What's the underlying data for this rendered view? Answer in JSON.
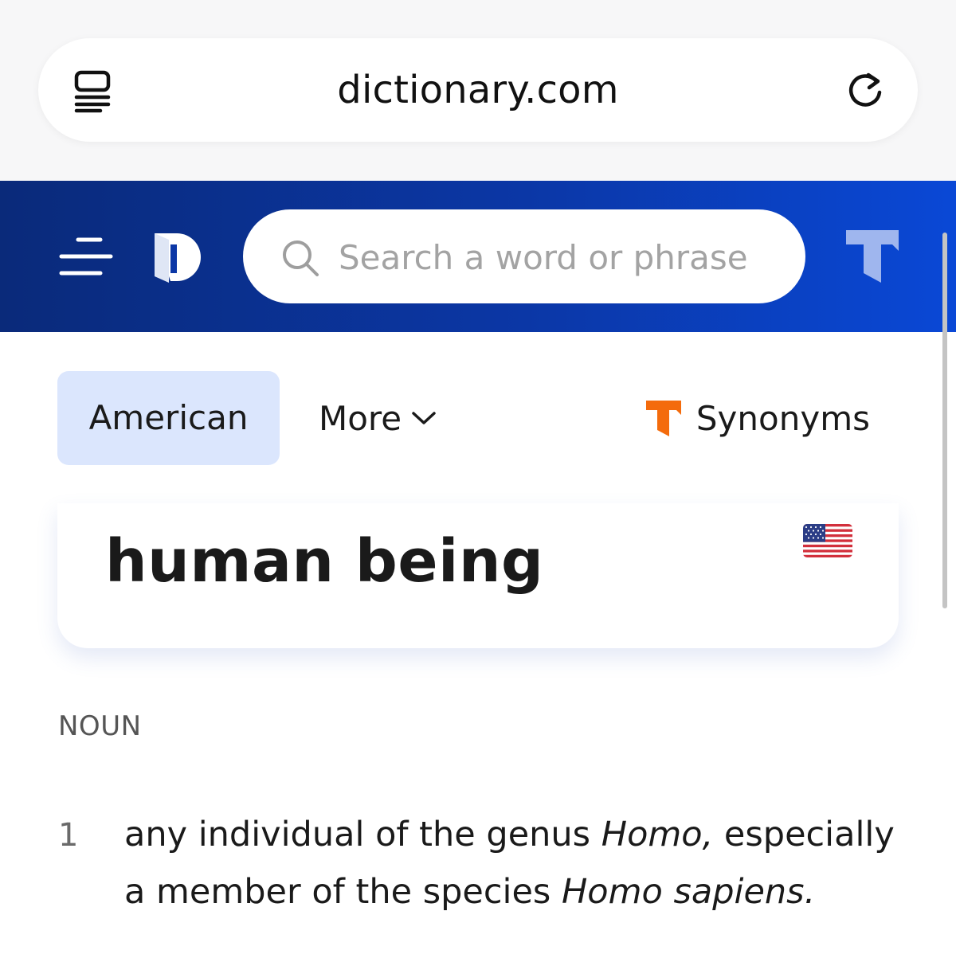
{
  "browser": {
    "url": "dictionary.com"
  },
  "header": {
    "search_placeholder": "Search a word or phrase"
  },
  "tabs": {
    "american": "American",
    "more": "More",
    "synonyms": "Synonyms"
  },
  "entry": {
    "headword": "human being",
    "part_of_speech": "NOUN",
    "definitions": [
      {
        "number": "1",
        "text_1": "any individual of the genus ",
        "italic_1": "Homo,",
        "text_2": " especially a member of the species ",
        "italic_2": "Homo sapiens."
      }
    ]
  },
  "colors": {
    "header_start": "#0a2a7a",
    "header_end": "#0a48d6",
    "tab_active_bg": "#dbe6fd",
    "thesaurus_orange": "#f46b0c"
  },
  "icons": {
    "reader": "reader-mode-icon",
    "reload": "reload-icon",
    "menu": "hamburger-menu-icon",
    "logo": "dictionary-logo-icon",
    "search": "search-icon",
    "thesaurus": "thesaurus-logo-icon",
    "flag": "us-flag-icon"
  }
}
